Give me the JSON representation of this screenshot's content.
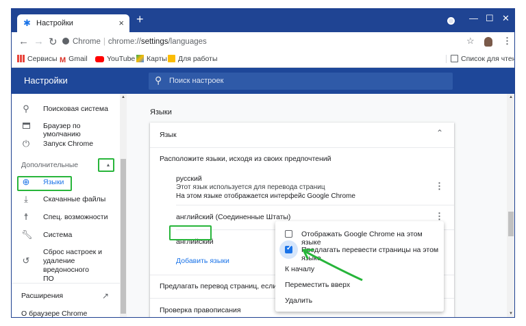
{
  "tab": {
    "title": "Настройки",
    "close": "×"
  },
  "new_tab": "+",
  "window": {
    "minimize": "—",
    "maximize": "☐",
    "close": "✕"
  },
  "omnibox": {
    "host": "Chrome",
    "scheme": "chrome://",
    "path": "settings",
    "rest": "/languages"
  },
  "bookmarks": [
    {
      "label": "Сервисы",
      "color": "#e8453c"
    },
    {
      "label": "Gmail",
      "color": "#d93025"
    },
    {
      "label": "YouTube",
      "color": "#ff0000"
    },
    {
      "label": "Карты",
      "color": "#34a853"
    },
    {
      "label": "Для работы",
      "color": "#fbbc04"
    }
  ],
  "reading_list": "Список для чтения",
  "header": {
    "title": "Настройки",
    "search_placeholder": "Поиск настроек"
  },
  "sidebar": {
    "items": [
      {
        "label": "Поисковая система",
        "icon": "search-icon"
      },
      {
        "label": "Браузер по умолчанию",
        "icon": "browser-icon"
      },
      {
        "label": "Запуск Chrome",
        "icon": "power-icon"
      }
    ],
    "advanced": "Дополнительные",
    "adv_items": [
      {
        "label": "Языки",
        "icon": "globe-icon"
      },
      {
        "label": "Скачанные файлы",
        "icon": "download-icon"
      },
      {
        "label": "Спец. возможности",
        "icon": "accessibility-icon"
      },
      {
        "label": "Система",
        "icon": "wrench-icon"
      }
    ],
    "reset": {
      "line1": "Сброс настроек и",
      "line2": "удаление вредоносного",
      "line3": "ПО"
    },
    "extensions": "Расширения",
    "about": "О браузере Chrome"
  },
  "content": {
    "section_title": "Языки",
    "card_header": "Язык",
    "instruction": "Расположите языки, исходя из своих предпочтений",
    "languages": [
      {
        "name": "русский",
        "note1": "Этот язык используется для перевода страниц",
        "note2": "На этом языке отображается интерфейс Google Chrome"
      },
      {
        "name": "английский (Соединенные Штаты)"
      },
      {
        "name": "английский"
      }
    ],
    "add_languages": "Добавить языки",
    "offer_translate": "Предлагать перевод страниц, если их язык",
    "spellcheck": "Проверка правописания"
  },
  "menu": {
    "display_in_lang": "Отображать Google Chrome на этом языке",
    "offer_translate_lang": "Предлагать перевести страницы на этом языке",
    "move_top": "К началу",
    "move_up": "Переместить вверх",
    "remove": "Удалить"
  },
  "state": {
    "display_checked": false,
    "translate_checked": true
  },
  "colors": {
    "titlebar": "#1f4493",
    "header": "#1e4799",
    "link": "#1a73e8",
    "highlight": "#27b53a"
  }
}
